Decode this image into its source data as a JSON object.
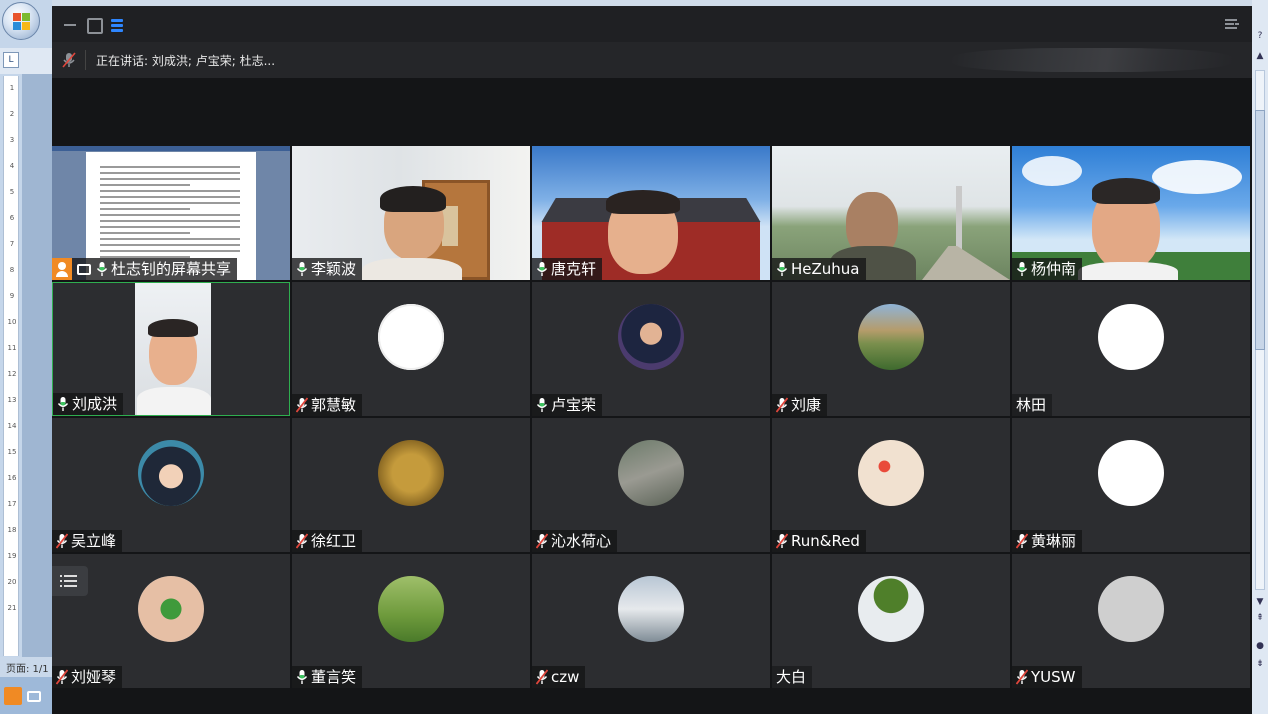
{
  "background_app": {
    "status_text": "页面: 1/1",
    "ruler_marks": [
      "1",
      "2",
      "3",
      "4",
      "5",
      "6",
      "7",
      "8",
      "9",
      "10",
      "11",
      "12",
      "13",
      "14",
      "15",
      "16",
      "17",
      "18",
      "19",
      "20",
      "21"
    ]
  },
  "meeting": {
    "speaking_label": "正在讲话: 刘成洪; 卢宝荣; 杜志...",
    "accent_blue": "#2e86ff",
    "active_border": "#2fae4f",
    "muted_red": "#e0463c",
    "participants": [
      {
        "name": "杜志钊的屏幕共享",
        "mic": "on",
        "kind": "screen-share",
        "icon": "person-icon"
      },
      {
        "name": "李颖波",
        "mic": "on",
        "kind": "video",
        "scene": "office"
      },
      {
        "name": "唐克轩",
        "mic": "on",
        "kind": "video",
        "scene": "temple"
      },
      {
        "name": "HeZuhua",
        "mic": "on",
        "kind": "video",
        "scene": "field"
      },
      {
        "name": "杨仲南",
        "mic": "on",
        "kind": "video",
        "scene": "sky"
      },
      {
        "name": "刘成洪",
        "mic": "on",
        "kind": "video",
        "scene": "portrait",
        "active": true
      },
      {
        "name": "郭慧敏",
        "mic": "muted",
        "kind": "avatar",
        "avatar": "cartoon-girl"
      },
      {
        "name": "卢宝荣",
        "mic": "on",
        "kind": "avatar",
        "avatar": "speaker-man"
      },
      {
        "name": "刘康",
        "mic": "muted",
        "kind": "avatar",
        "avatar": "building"
      },
      {
        "name": "林田",
        "mic": "none",
        "kind": "avatar",
        "avatar": "meditation"
      },
      {
        "name": "吴立峰",
        "mic": "muted",
        "kind": "avatar",
        "avatar": "anime-boy"
      },
      {
        "name": "徐红卫",
        "mic": "muted",
        "kind": "avatar",
        "avatar": "wheat"
      },
      {
        "name": "沁水荷心",
        "mic": "muted",
        "kind": "avatar",
        "avatar": "path"
      },
      {
        "name": "Run&Red",
        "mic": "muted",
        "kind": "avatar",
        "avatar": "ladybugs"
      },
      {
        "name": "黄琳丽",
        "mic": "muted",
        "kind": "avatar",
        "avatar": "cartoon-kid"
      },
      {
        "name": "刘娅琴",
        "mic": "muted",
        "kind": "avatar",
        "avatar": "clover"
      },
      {
        "name": "董言笑",
        "mic": "on",
        "kind": "avatar",
        "avatar": "child-field"
      },
      {
        "name": "czw",
        "mic": "muted",
        "kind": "avatar",
        "avatar": "opera-house"
      },
      {
        "name": "大白",
        "mic": "none",
        "kind": "avatar",
        "avatar": "palm-tree"
      },
      {
        "name": "YUSW",
        "mic": "muted",
        "kind": "avatar",
        "avatar": "sketch"
      }
    ]
  }
}
